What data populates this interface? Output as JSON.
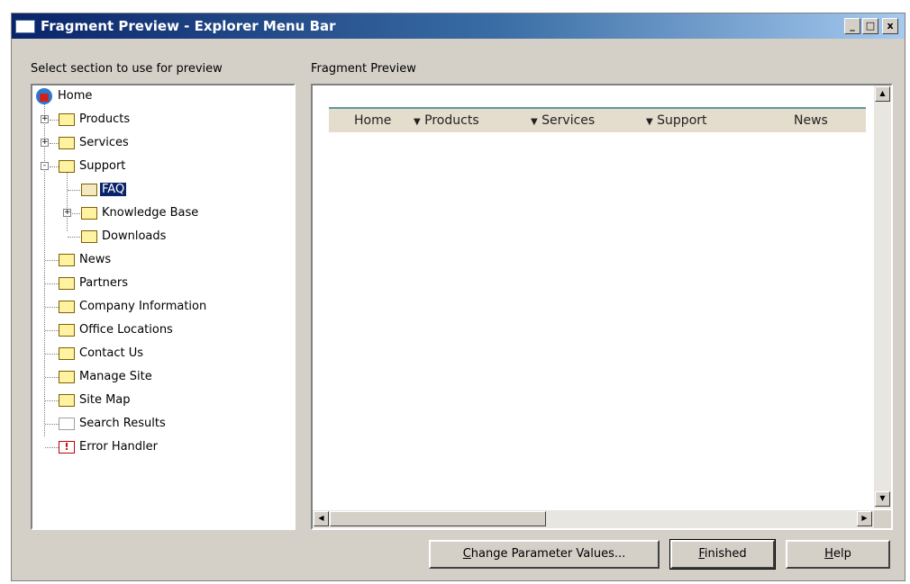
{
  "window": {
    "title": "Fragment Preview - Explorer Menu Bar",
    "controls": {
      "minimize": "_",
      "maximize": "□",
      "close": "x"
    }
  },
  "left_panel": {
    "label": "Select section to use for preview",
    "tree": [
      {
        "label": "Home",
        "icon": "home-icon",
        "level": 0
      },
      {
        "label": "Products",
        "icon": "folder-icon",
        "level": 1,
        "expander": "+"
      },
      {
        "label": "Services",
        "icon": "folder-icon",
        "level": 1,
        "expander": "+"
      },
      {
        "label": "Support",
        "icon": "folder-icon",
        "level": 1,
        "expander": "-"
      },
      {
        "label": "FAQ",
        "icon": "open-folder-icon",
        "level": 2,
        "selected": true
      },
      {
        "label": "Knowledge Base",
        "icon": "folder-icon",
        "level": 2,
        "expander": "+"
      },
      {
        "label": "Downloads",
        "icon": "folder-icon",
        "level": 2
      },
      {
        "label": "News",
        "icon": "folder-icon",
        "level": 1
      },
      {
        "label": "Partners",
        "icon": "folder-icon",
        "level": 1
      },
      {
        "label": "Company Information",
        "icon": "folder-icon",
        "level": 1
      },
      {
        "label": "Office Locations",
        "icon": "folder-icon",
        "level": 1
      },
      {
        "label": "Contact Us",
        "icon": "folder-icon",
        "level": 1
      },
      {
        "label": "Manage Site",
        "icon": "folder-icon",
        "level": 1
      },
      {
        "label": "Site Map",
        "icon": "folder-icon",
        "level": 1
      },
      {
        "label": "Search Results",
        "icon": "blank-page-icon",
        "level": 1
      },
      {
        "label": "Error Handler",
        "icon": "error-icon",
        "level": 1
      }
    ]
  },
  "right_panel": {
    "label": "Fragment Preview",
    "menu": [
      {
        "label": "Home",
        "dropdown": false
      },
      {
        "label": "Products",
        "dropdown": true
      },
      {
        "label": "Services",
        "dropdown": true
      },
      {
        "label": "Support",
        "dropdown": true
      },
      {
        "label": "News",
        "dropdown": false
      }
    ],
    "dropdown_glyph": "▼"
  },
  "buttons": {
    "change_params": {
      "underline": "C",
      "rest": "hange Parameter Values..."
    },
    "finished": {
      "underline": "F",
      "rest": "inished"
    },
    "help": {
      "underline": "H",
      "rest": "elp"
    }
  },
  "colors": {
    "titlebar_start": "#0a246a",
    "selection": "#0a246a",
    "dialog_face": "#d4d0c8",
    "menubar_bg": "#e4dccc",
    "menubar_accent": "#5a9a9a"
  }
}
